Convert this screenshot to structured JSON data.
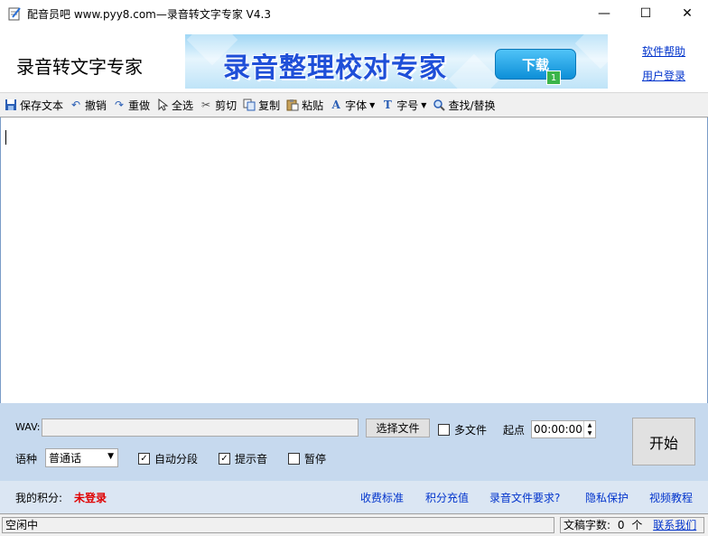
{
  "window": {
    "title": "配音员吧 www.pyy8.com—录音转文字专家 V4.3",
    "controls": {
      "minimize": "—",
      "maximize": "☐",
      "close": "✕"
    }
  },
  "header": {
    "app_name": "录音转文字专家",
    "banner": {
      "text": "录音整理校对专家",
      "button": "下载",
      "badge": "1"
    },
    "links": {
      "help": "软件帮助",
      "login": "用户登录"
    }
  },
  "toolbar": {
    "items": [
      {
        "label": "保存文本",
        "icon": "save-icon"
      },
      {
        "label": "撤销",
        "icon": "undo-icon"
      },
      {
        "label": "重做",
        "icon": "redo-icon"
      },
      {
        "label": "全选",
        "icon": "select-all-icon"
      },
      {
        "label": "剪切",
        "icon": "cut-icon"
      },
      {
        "label": "复制",
        "icon": "copy-icon"
      },
      {
        "label": "粘贴",
        "icon": "paste-icon"
      },
      {
        "label": "字体",
        "icon": "font-icon"
      },
      {
        "label": "字号",
        "icon": "font-size-icon"
      },
      {
        "label": "查找/替换",
        "icon": "search-icon"
      }
    ]
  },
  "editor": {
    "content": ""
  },
  "controls": {
    "wav_label": "WAV:",
    "wav_value": "",
    "select_file": "选择文件",
    "multi_file": "多文件",
    "start_point_label": "起点",
    "start_time": "00:00:00",
    "language_label": "语种",
    "language_value": "普通话",
    "auto_segment": "自动分段",
    "auto_segment_checked": true,
    "prompt_sound": "提示音",
    "prompt_sound_checked": true,
    "pause": "暂停",
    "pause_checked": false,
    "start_button": "开始"
  },
  "info_bar": {
    "score_label": "我的积分:",
    "score_value": "未登录",
    "links": [
      "收费标准",
      "积分充值",
      "录音文件要求?",
      "隐私保护",
      "视频教程"
    ]
  },
  "status": {
    "state": "空闲中",
    "word_count_label": "文稿字数:",
    "word_count": "0",
    "unit": "个",
    "contact": "联系我们"
  },
  "colors": {
    "accent_link": "#0033cc",
    "warning_red": "#e00000",
    "panel_blue": "#c6d9ee",
    "info_bar": "#dbe6f3"
  }
}
